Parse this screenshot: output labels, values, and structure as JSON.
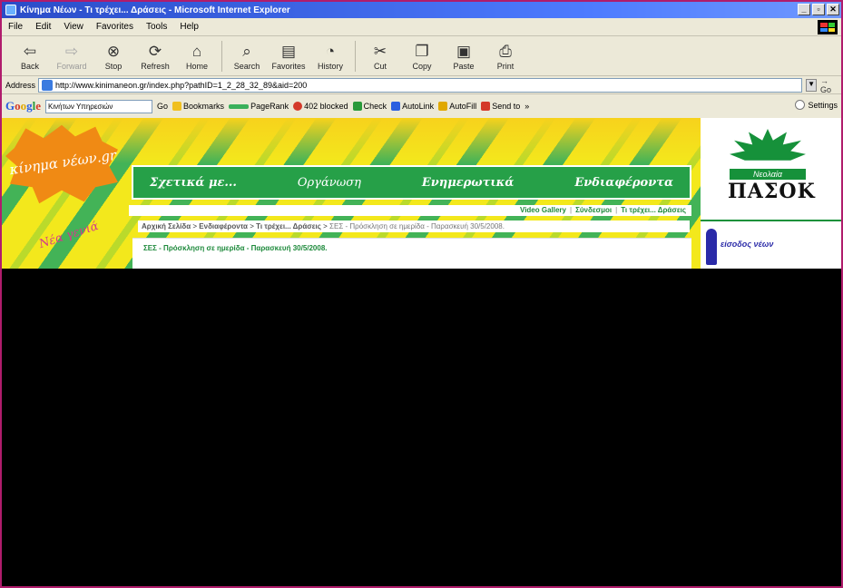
{
  "window": {
    "title": "Κίνημα Νέων - Τι τρέχει... Δράσεις - Microsoft Internet Explorer",
    "buttons": [
      "_",
      "▫",
      "✕"
    ]
  },
  "menubar": {
    "items": [
      "File",
      "Edit",
      "View",
      "Favorites",
      "Tools",
      "Help"
    ]
  },
  "toolbar": {
    "back": "Back",
    "forward": "Forward",
    "stop": "Stop",
    "refresh": "Refresh",
    "home": "Home",
    "search": "Search",
    "favorites": "Favorites",
    "history": "History",
    "cut": "Cut",
    "copy": "Copy",
    "paste": "Paste",
    "print": "Print"
  },
  "address": {
    "label": "Address",
    "url": "http://www.kinimaneon.gr/index.php?pathID=1_2_28_32_89&aid=200",
    "go": "Go"
  },
  "google_bar": {
    "logo": [
      "G",
      "o",
      "o",
      "g",
      "l",
      "e"
    ],
    "search_text": "Κινήτων Υπηρεσιών",
    "go": "Go",
    "bookmarks": "Bookmarks",
    "pagerank": "PageRank",
    "blocked": "402 blocked",
    "check": "Check",
    "autolink": "AutoLink",
    "autofill": "AutoFill",
    "sendto": "Send to",
    "more": "»",
    "settings": "Settings"
  },
  "site": {
    "logo_text": "κίνημα νέων.gr",
    "tagline": "Νέα γενιά",
    "nav": [
      "Σχετικά με...",
      "Οργάνωση",
      "Ενημερωτικά",
      "Ενδιαφέροντα"
    ],
    "sublinks": [
      "Video Gallery",
      "Σύνδεσμοι",
      "Τι τρέχει... Δράσεις"
    ],
    "breadcrumb": {
      "home": "Αρχική Σελίδα",
      "level1": "Ενδιαφέροντα",
      "level2": "Τι τρέχει... Δράσεις",
      "current": "ΣΕΣ - Πρόσκληση σε ημερίδα - Παρασκευή 30/5/2008."
    },
    "content_title": "ΣΕΣ - Πρόσκληση σε ημερίδα - Παρασκευή 30/5/2008.",
    "right": {
      "neolaia": "Νεολαία",
      "pasok": "ΠΑΣΟΚ",
      "eisodos": "είσοδος νέων"
    }
  },
  "colors": {
    "accent_green": "#26a048",
    "site_yellow": "#f3e81c",
    "frame_border": "#b01c6c"
  }
}
